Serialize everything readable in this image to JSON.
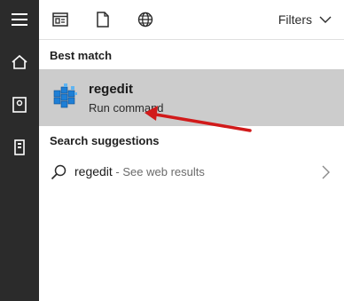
{
  "toolbar": {
    "filters_label": "Filters",
    "icons": [
      "apps-icon",
      "document-icon",
      "web-globe-icon"
    ]
  },
  "rail": {
    "icons": [
      "hamburger-menu-icon",
      "home-icon",
      "notebook-icon",
      "device-tower-icon"
    ]
  },
  "sections": {
    "best_match": "Best match",
    "search_suggestions": "Search suggestions"
  },
  "best_match_result": {
    "title": "regedit",
    "subtitle": "Run command",
    "icon": "registry-editor-icon"
  },
  "suggestion": {
    "query": "regedit",
    "hint": " - See web results",
    "icon": "search-icon"
  },
  "colors": {
    "rail_bg": "#2b2b2b",
    "selected_bg": "#cccccc",
    "arrow": "#d11a1a",
    "icon_blue": "#1e7fd6"
  }
}
